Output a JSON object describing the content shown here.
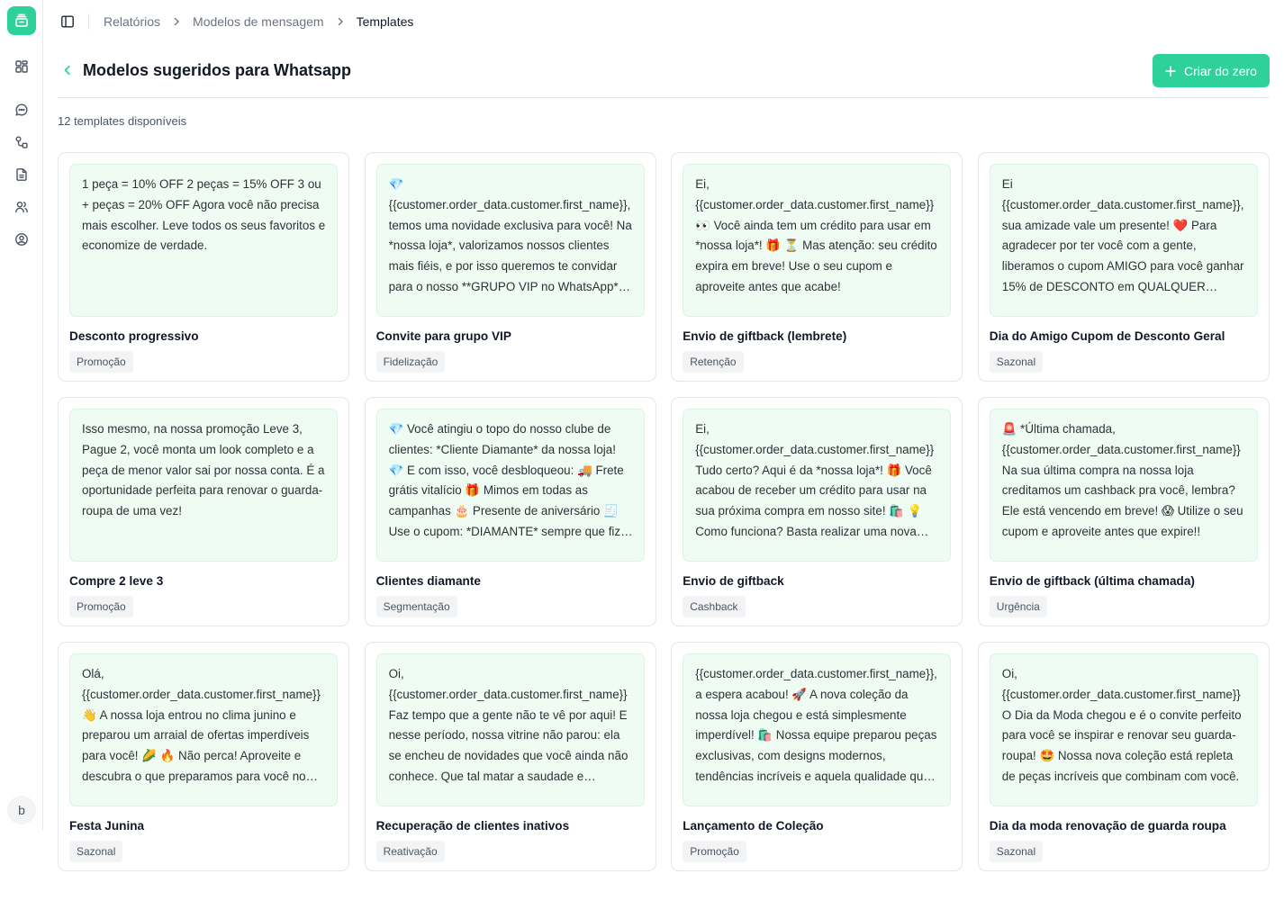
{
  "sidebar": {
    "logo_icon": "stack-icon",
    "items": [
      {
        "icon": "dashboard-icon"
      },
      {
        "icon": "chat-icon"
      },
      {
        "icon": "flow-icon"
      },
      {
        "icon": "document-icon"
      },
      {
        "icon": "users-icon"
      },
      {
        "icon": "account-icon"
      }
    ],
    "avatar_initial": "b"
  },
  "breadcrumb": {
    "items": [
      "Relatórios",
      "Modelos de mensagem"
    ],
    "current": "Templates"
  },
  "header": {
    "title": "Modelos sugeridos para Whatsapp",
    "create_button": "Criar do zero"
  },
  "templates_count": "12 templates disponíveis",
  "colors": {
    "accent": "#2fd19a",
    "preview_bg": "#effcf4"
  },
  "templates": [
    {
      "preview": "1 peça = 10% OFF 2 peças = 15% OFF 3 ou + peças = 20% OFF Agora você não precisa mais escolher. Leve todos os seus favoritos e economize de verdade.",
      "title": "Desconto progressivo",
      "tag": "Promoção"
    },
    {
      "preview": "💎 {{customer.order_data.customer.first_name}}, temos uma novidade exclusiva para você! Na *nossa loja*, valorizamos nossos clientes mais fiéis, e por isso queremos te convidar para o nosso **GRUPO VIP no WhatsApp** para receber ofertas exclusivas.",
      "title": "Convite para grupo VIP",
      "tag": "Fidelização"
    },
    {
      "preview": "Ei, {{customer.order_data.customer.first_name}} 👀 Você ainda tem um crédito para usar em *nossa loja*! 🎁 ⏳ Mas atenção: seu crédito expira em breve! Use o seu cupom e aproveite antes que acabe!",
      "title": "Envio de giftback (lembrete)",
      "tag": "Retenção"
    },
    {
      "preview": "Ei {{customer.order_data.customer.first_name}}, sua amizade vale um presente! ❤️ Para agradecer por ter você com a gente, liberamos o cupom AMIGO para você ganhar 15% de DESCONTO em QUALQUER produto da loja.",
      "title": "Dia do Amigo Cupom de Desconto Geral",
      "tag": "Sazonal"
    },
    {
      "preview": "Isso mesmo, na nossa promoção Leve 3, Pague 2, você monta um look completo e a peça de menor valor sai por nossa conta. É a oportunidade perfeita para renovar o guarda-roupa de uma vez!",
      "title": "Compre 2 leve 3",
      "tag": "Promoção"
    },
    {
      "preview": "💎 Você atingiu o topo do nosso clube de clientes: *Cliente Diamante* da nossa loja! 💎 E com isso, você desbloqueou: 🚚 Frete grátis vitalício 🎁 Mimos em todas as campanhas 🎂 Presente de aniversário 🧾 Use o cupom: *DIAMANTE* sempre que fizer uma compra.",
      "title": "Clientes diamante",
      "tag": "Segmentação"
    },
    {
      "preview": "Ei, {{customer.order_data.customer.first_name}} Tudo certo? Aqui é da *nossa loja*! 🎁 Você acabou de receber um crédito para usar na sua próxima compra em nosso site! 🛍️ 💡 Como funciona? Basta realizar uma nova compra.",
      "title": "Envio de giftback",
      "tag": "Cashback"
    },
    {
      "preview": "🚨 *Última chamada, {{customer.order_data.customer.first_name}} Na sua última compra na nossa loja creditamos um cashback pra você, lembra? Ele está vencendo em breve! 😱 Utilize o seu cupom e aproveite antes que expire!!",
      "title": "Envio de giftback (última chamada)",
      "tag": "Urgência"
    },
    {
      "preview": "Olá, {{customer.order_data.customer.first_name}} 👋 A nossa loja entrou no clima junino e preparou um arraial de ofertas imperdíveis para você! 🌽 🔥 Não perca! Aproveite e descubra o que preparamos para você no site.",
      "title": "Festa Junina",
      "tag": "Sazonal"
    },
    {
      "preview": "Oi, {{customer.order_data.customer.first_name}} Faz tempo que a gente não te vê por aqui! E nesse período, nossa vitrine não parou: ela se encheu de novidades que você ainda não conhece. Que tal matar a saudade e conferir?",
      "title": "Recuperação de clientes inativos",
      "tag": "Reativação"
    },
    {
      "preview": "{{customer.order_data.customer.first_name}}, a espera acabou! 🚀 A nova coleção da nossa loja chegou e está simplesmente imperdível! 🛍️ Nossa equipe preparou peças exclusivas, com designs modernos, tendências incríveis e aquela qualidade que você já conhece.",
      "title": "Lançamento de Coleção",
      "tag": "Promoção"
    },
    {
      "preview": "Oi, {{customer.order_data.customer.first_name}} O Dia da Moda chegou e é o convite perfeito para você se inspirar e renovar seu guarda-roupa! 🤩 Nossa nova coleção está repleta de peças incríveis que combinam com você.",
      "title": "Dia da moda renovação de guarda roupa",
      "tag": "Sazonal"
    }
  ]
}
